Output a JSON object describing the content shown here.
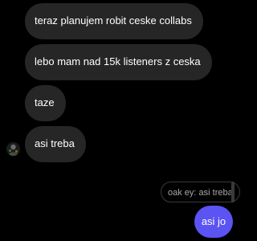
{
  "colors": {
    "background": "#000000",
    "received_bubble": "#262626",
    "sent_bubble": "#5b53f2",
    "reply_preview_text": "#a8a8a8"
  },
  "received_messages": [
    {
      "text": "teraz planujem robit ceske collabs"
    },
    {
      "text": "lebo mam nad 15k listeners z ceska"
    },
    {
      "text": "taze"
    },
    {
      "text": "asi treba"
    }
  ],
  "reply_preview": {
    "text": "oak ey: asi treba"
  },
  "sent_message": {
    "text": "asi jo"
  }
}
